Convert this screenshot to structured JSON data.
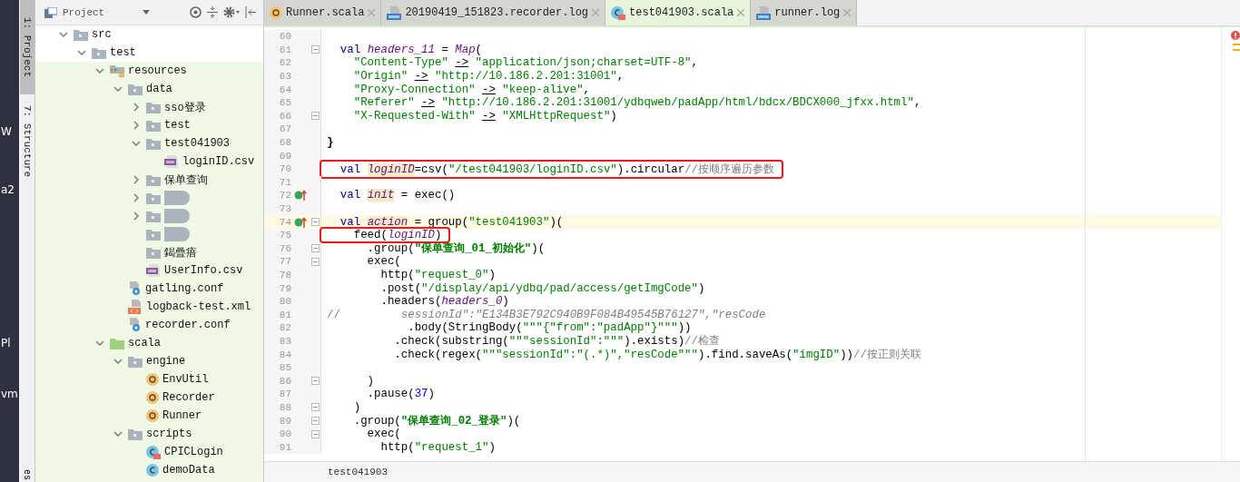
{
  "desktop_fragments": [
    "W",
    "a2",
    "Pl",
    "vm"
  ],
  "tool_strip": [
    {
      "label": "1: Project",
      "selected": true
    },
    {
      "label": "7: Structure",
      "selected": false
    }
  ],
  "tool_strip_cut": "es",
  "project_panel": {
    "title": "Project"
  },
  "tree": [
    {
      "label": "src",
      "kind": "folder",
      "expanded": true,
      "in_scope": false,
      "children": [
        {
          "label": "test",
          "kind": "folder",
          "expanded": true,
          "in_scope": false,
          "children": [
            {
              "label": "resources",
              "kind": "resources",
              "expanded": true,
              "children": [
                {
                  "label": "data",
                  "kind": "folder",
                  "expanded": true,
                  "children": [
                    {
                      "label": "sso登录",
                      "kind": "folder",
                      "expanded": false
                    },
                    {
                      "label": "test",
                      "kind": "folder",
                      "expanded": false
                    },
                    {
                      "label": "test041903",
                      "kind": "folder",
                      "expanded": true,
                      "children": [
                        {
                          "label": "loginID.csv",
                          "kind": "csv"
                        }
                      ]
                    },
                    {
                      "label": "保单查询",
                      "kind": "folder",
                      "expanded": false
                    },
                    {
                      "kind": "redacted",
                      "expanded": false
                    },
                    {
                      "kind": "redacted",
                      "expanded": false
                    },
                    {
                      "kind": "redacted"
                    },
                    {
                      "label": "鍻曡瘖",
                      "kind": "folder"
                    },
                    {
                      "label": "UserInfo.csv",
                      "kind": "csv"
                    }
                  ]
                },
                {
                  "label": "gatling.conf",
                  "kind": "conf"
                },
                {
                  "label": "logback-test.xml",
                  "kind": "xml"
                },
                {
                  "label": "recorder.conf",
                  "kind": "conf"
                }
              ]
            },
            {
              "label": "scala",
              "kind": "source",
              "expanded": true,
              "children": [
                {
                  "label": "engine",
                  "kind": "folder",
                  "expanded": true,
                  "children": [
                    {
                      "label": "EnvUtil",
                      "kind": "object"
                    },
                    {
                      "label": "Recorder",
                      "kind": "object"
                    },
                    {
                      "label": "Runner",
                      "kind": "object"
                    }
                  ]
                },
                {
                  "label": "scripts",
                  "kind": "folder",
                  "expanded": true,
                  "children": [
                    {
                      "label": "CPICLogin",
                      "kind": "class-error"
                    },
                    {
                      "label": "demoData",
                      "kind": "class"
                    }
                  ]
                }
              ]
            }
          ]
        }
      ]
    }
  ],
  "tabs": [
    {
      "label": "Runner.scala",
      "kind": "object",
      "selected": false
    },
    {
      "label": "20190419_151823.recorder.log",
      "kind": "log",
      "selected": false
    },
    {
      "label": "test041903.scala",
      "kind": "class-error",
      "selected": true
    },
    {
      "label": "runner.log",
      "kind": "log",
      "selected": false
    }
  ],
  "code": [
    {
      "number": "60"
    },
    {
      "number": "61",
      "fold": true,
      "seg": [
        {
          "kind": "kw",
          "text": "  val "
        },
        {
          "kind": "fld",
          "text": "headers_11"
        },
        {
          "kind": "pl",
          "text": " = "
        },
        {
          "kind": "fld",
          "text": "Map"
        },
        {
          "kind": "pl",
          "text": "("
        }
      ]
    },
    {
      "number": "62",
      "seg": [
        {
          "kind": "str",
          "text": "    \"Content-Type\" "
        },
        {
          "kind": "arr",
          "text": "->"
        },
        {
          "kind": "str",
          "text": " \"application/json;charset=UTF-8\""
        },
        {
          "kind": "pl",
          "text": ","
        }
      ]
    },
    {
      "number": "63",
      "seg": [
        {
          "kind": "str",
          "text": "    \"Origin\" "
        },
        {
          "kind": "arr",
          "text": "->"
        },
        {
          "kind": "str",
          "text": " \"http://10.186.2.201:31001\""
        },
        {
          "kind": "pl",
          "text": ","
        }
      ]
    },
    {
      "number": "64",
      "seg": [
        {
          "kind": "str",
          "text": "    \"Proxy-Connection\" "
        },
        {
          "kind": "arr",
          "text": "->"
        },
        {
          "kind": "str",
          "text": " \"keep-alive\""
        },
        {
          "kind": "pl",
          "text": ","
        }
      ]
    },
    {
      "number": "65",
      "seg": [
        {
          "kind": "str",
          "text": "    \"Referer\" "
        },
        {
          "kind": "arr",
          "text": "->"
        },
        {
          "kind": "str",
          "text": " \"http://10.186.2.201:31001/ydbqweb/padApp/html/bdcx/BDCX000_jfxx.html\""
        },
        {
          "kind": "pl",
          "text": ","
        }
      ]
    },
    {
      "number": "66",
      "fold": true,
      "seg": [
        {
          "kind": "str",
          "text": "    \"X-Requested-With\" "
        },
        {
          "kind": "arr",
          "text": "->"
        },
        {
          "kind": "str",
          "text": " \"XMLHttpRequest\""
        },
        {
          "kind": "pl",
          "text": ")"
        }
      ]
    },
    {
      "number": "67"
    },
    {
      "number": "68",
      "seg": [
        {
          "kind": "brk",
          "text": "}"
        }
      ]
    },
    {
      "number": "69"
    },
    {
      "number": "70",
      "boxed": true,
      "seg": [
        {
          "kind": "kw",
          "text": "  val "
        },
        {
          "kind": "decl",
          "text": "loginID"
        },
        {
          "kind": "pl",
          "text": "=csv("
        },
        {
          "kind": "str",
          "text": "\"/test041903/loginID.csv\""
        },
        {
          "kind": "pl",
          "text": ").circular"
        },
        {
          "kind": "cm",
          "text": "//按顺序遍历参数"
        }
      ]
    },
    {
      "number": "71"
    },
    {
      "number": "72",
      "implements": true,
      "seg": [
        {
          "kind": "kw",
          "text": "  val "
        },
        {
          "kind": "decl",
          "text": "init"
        },
        {
          "kind": "pl",
          "text": " = exec()"
        }
      ]
    },
    {
      "number": "73"
    },
    {
      "number": "74",
      "implements": true,
      "fold": true,
      "current": true,
      "seg": [
        {
          "kind": "kw",
          "text": "  val "
        },
        {
          "kind": "decl",
          "text": "action"
        },
        {
          "kind": "pl",
          "text": " = group("
        },
        {
          "kind": "str",
          "text": "\"test041903\""
        },
        {
          "kind": "pl",
          "text": ")("
        }
      ]
    },
    {
      "number": "75",
      "boxed": true,
      "seg": [
        {
          "kind": "pl",
          "text": "    feed("
        },
        {
          "kind": "fld",
          "text": "loginID"
        },
        {
          "kind": "pl",
          "text": ")"
        }
      ]
    },
    {
      "number": "76",
      "fold": true,
      "seg": [
        {
          "kind": "pl",
          "text": "      .group("
        },
        {
          "kind": "strb",
          "text": "\"保单查询_01_初始化\""
        },
        {
          "kind": "pl",
          "text": ")("
        }
      ]
    },
    {
      "number": "77",
      "fold": true,
      "seg": [
        {
          "kind": "pl",
          "text": "      exec("
        }
      ]
    },
    {
      "number": "78",
      "seg": [
        {
          "kind": "pl",
          "text": "        http("
        },
        {
          "kind": "str",
          "text": "\"request_0\""
        },
        {
          "kind": "pl",
          "text": ")"
        }
      ]
    },
    {
      "number": "79",
      "seg": [
        {
          "kind": "pl",
          "text": "        .post("
        },
        {
          "kind": "str",
          "text": "\"/display/api/ydbq/pad/access/getImgCode\""
        },
        {
          "kind": "pl",
          "text": ")"
        }
      ]
    },
    {
      "number": "80",
      "seg": [
        {
          "kind": "pl",
          "text": "        .headers("
        },
        {
          "kind": "fld",
          "text": "headers_0"
        },
        {
          "kind": "pl",
          "text": ")"
        }
      ]
    },
    {
      "number": "81",
      "seg": [
        {
          "kind": "cm",
          "text": "//         "
        },
        {
          "kind": "cmi",
          "text": "sessionId\":\"E134B3E792C940B9F084B49545B76127\",\"resCode"
        }
      ]
    },
    {
      "number": "82",
      "seg": [
        {
          "kind": "pl",
          "text": "            .body(StringBody("
        },
        {
          "kind": "str",
          "text": "\"\"\"{\"from\":\"padApp\"}\"\"\""
        },
        {
          "kind": "pl",
          "text": "))"
        }
      ]
    },
    {
      "number": "83",
      "seg": [
        {
          "kind": "pl",
          "text": "          .check(substring("
        },
        {
          "kind": "str",
          "text": "\"\"\"sessionId\":\"\"\""
        },
        {
          "kind": "pl",
          "text": ").exists)"
        },
        {
          "kind": "cm",
          "text": "//检查"
        }
      ]
    },
    {
      "number": "84",
      "seg": [
        {
          "kind": "pl",
          "text": "          .check(regex("
        },
        {
          "kind": "str",
          "text": "\"\"\"sessionId\":\"(.*)\",\"resCode\"\"\""
        },
        {
          "kind": "pl",
          "text": ").find.saveAs("
        },
        {
          "kind": "str",
          "text": "\"imgID\""
        },
        {
          "kind": "pl",
          "text": "))"
        },
        {
          "kind": "cm",
          "text": "//按正则关联"
        }
      ]
    },
    {
      "number": "85"
    },
    {
      "number": "86",
      "fold": true,
      "seg": [
        {
          "kind": "pl",
          "text": "      )"
        }
      ]
    },
    {
      "number": "87",
      "seg": [
        {
          "kind": "pl",
          "text": "      .pause("
        },
        {
          "kind": "num",
          "text": "37"
        },
        {
          "kind": "pl",
          "text": ")"
        }
      ]
    },
    {
      "number": "88",
      "fold": true,
      "seg": [
        {
          "kind": "pl",
          "text": "    )"
        }
      ]
    },
    {
      "number": "89",
      "fold": true,
      "seg": [
        {
          "kind": "pl",
          "text": "    .group("
        },
        {
          "kind": "strb",
          "text": "\"保单查询_02_登录\""
        },
        {
          "kind": "pl",
          "text": ")("
        }
      ]
    },
    {
      "number": "90",
      "fold": true,
      "seg": [
        {
          "kind": "pl",
          "text": "      exec("
        }
      ]
    },
    {
      "number": "91",
      "seg": [
        {
          "kind": "pl",
          "text": "        http("
        },
        {
          "kind": "str",
          "text": "\"request_1\""
        },
        {
          "kind": "pl",
          "text": ")"
        }
      ]
    }
  ],
  "breadcrumb": "test041903"
}
